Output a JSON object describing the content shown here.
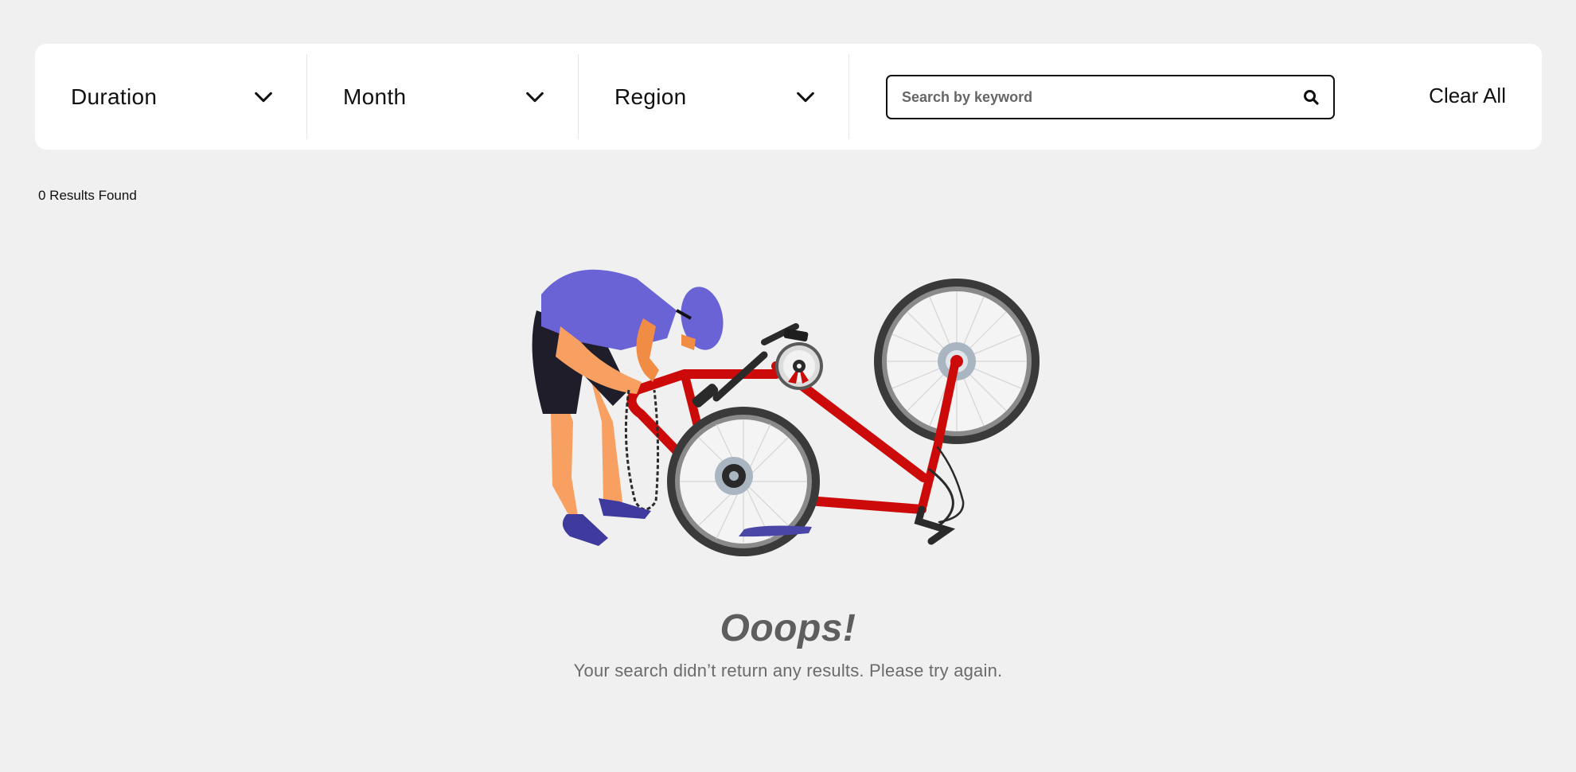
{
  "filters": {
    "dropdowns": [
      {
        "label": "Duration",
        "icon": "chevron-down-icon"
      },
      {
        "label": "Month",
        "icon": "chevron-down-icon"
      },
      {
        "label": "Region",
        "icon": "chevron-down-icon"
      }
    ],
    "search": {
      "placeholder": "Search by keyword",
      "value": "",
      "icon": "search-icon"
    },
    "clear_all_label": "Clear All"
  },
  "results": {
    "count_text": "0 Results Found"
  },
  "empty_state": {
    "illustration": "cyclist-fixing-bike-illustration",
    "title": "Ooops!",
    "message": "Your search didn’t return any results. Please try again."
  },
  "colors": {
    "background": "#f0f0f0",
    "panel": "#ffffff",
    "bike_frame": "#cc0a0a",
    "jersey": "#6a63d6",
    "skin": "#f7a062",
    "title_gray": "#5e5e5e"
  }
}
